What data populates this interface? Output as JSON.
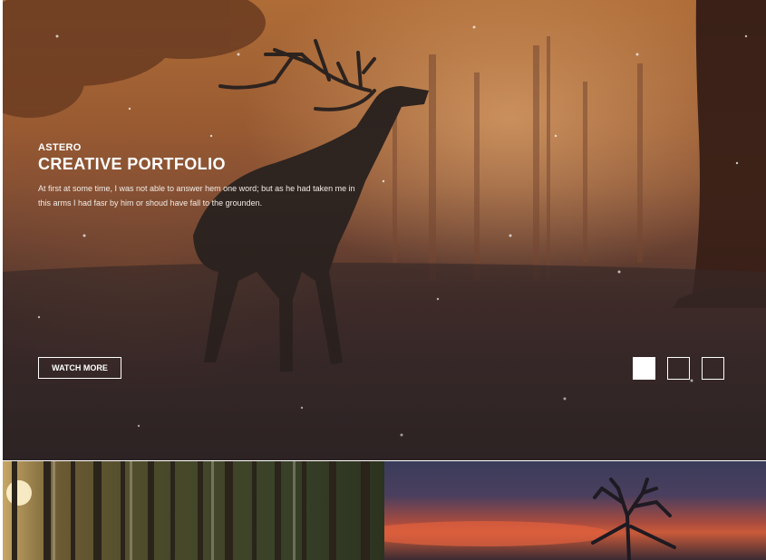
{
  "hero": {
    "kicker": "ASTERO",
    "title": "CREATIVE PORTFOLIO",
    "description": "At first at some time, I was not able to answer hem one word; but as he had taken me in this arms I had fasr by him or shoud have fall to the grounden.",
    "button_label": "WATCH MORE",
    "slides": {
      "count": 3,
      "active": 1
    }
  },
  "gallery": {
    "tiles": [
      {
        "name": "forest-image"
      },
      {
        "name": "sunset-tree-image"
      }
    ]
  },
  "colors": {
    "text": "#ffffff",
    "hero_top": "#b8723a",
    "hero_bottom": "#2e2829"
  }
}
